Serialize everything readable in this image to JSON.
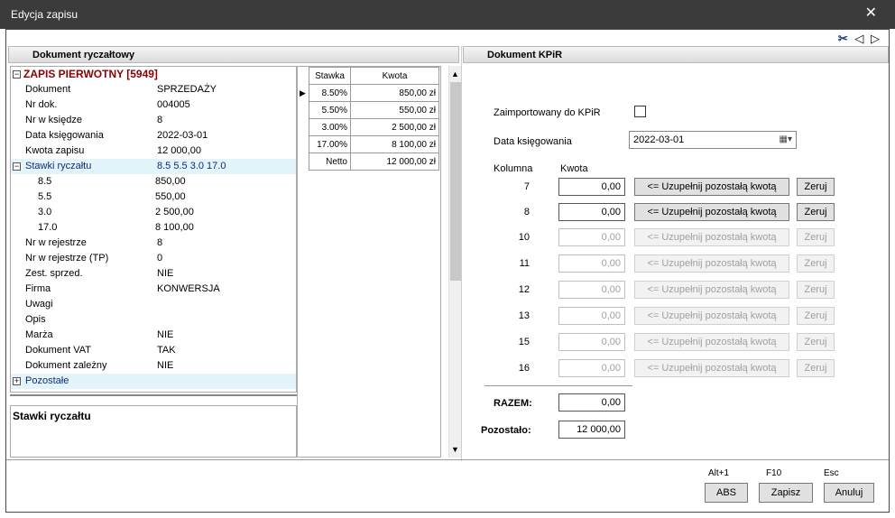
{
  "window": {
    "title": "Edycja zapisu",
    "close_glyph": "✕"
  },
  "toolbar": {
    "cut_icon": "✂",
    "prev_icon": "◁",
    "next_icon": "▷"
  },
  "left_panel": {
    "title": "Dokument ryczałtowy"
  },
  "right_panel": {
    "title": "Dokument KPiR"
  },
  "tree": {
    "root": {
      "label": "ZAPIS PIERWOTNY [5949]",
      "expander": "−"
    },
    "rows": [
      {
        "k": "Dokument",
        "v": "SPRZEDAŻY"
      },
      {
        "k": "Nr dok.",
        "v": "004005"
      },
      {
        "k": "Nr w księdze",
        "v": "8"
      },
      {
        "k": "Data księgowania",
        "v": "2022-03-01"
      },
      {
        "k": "Kwota zapisu",
        "v": " 12 000,00"
      }
    ],
    "stawki": {
      "k": "Stawki ryczałtu",
      "v": "8.5 5.5 3.0 17.0",
      "expander": "−"
    },
    "sub_rows": [
      {
        "k": "8.5",
        "v": "850,00"
      },
      {
        "k": "5.5",
        "v": "550,00"
      },
      {
        "k": "3.0",
        "v": " 2 500,00"
      },
      {
        "k": "17.0",
        "v": "8 100,00"
      }
    ],
    "rows2": [
      {
        "k": "Nr w rejestrze",
        "v": "8"
      },
      {
        "k": "Nr w rejestrze (TP)",
        "v": "0"
      },
      {
        "k": "Zest. sprzed.",
        "v": "NIE"
      },
      {
        "k": "Firma",
        "v": "KONWERSJA"
      },
      {
        "k": "Uwagi",
        "v": ""
      },
      {
        "k": "Opis",
        "v": ""
      },
      {
        "k": "Marża",
        "v": "NIE"
      },
      {
        "k": "Dokument VAT",
        "v": "TAK"
      },
      {
        "k": "Dokument zależny",
        "v": "NIE"
      }
    ],
    "pozostale": {
      "k": "Pozostałe",
      "expander": "+"
    }
  },
  "description": {
    "title": "Stawki ryczałtu"
  },
  "rates_table": {
    "headers": [
      "Stawka",
      "Kwota"
    ],
    "rows": [
      {
        "stawka": "8.50%",
        "kwota": "850,00 zł"
      },
      {
        "stawka": "5.50%",
        "kwota": "550,00 zł"
      },
      {
        "stawka": "3.00%",
        "kwota": "2 500,00 zł"
      },
      {
        "stawka": "17.00%",
        "kwota": "8 100,00 zł"
      },
      {
        "stawka": "Netto",
        "kwota": "12 000,00 zł"
      }
    ]
  },
  "kpir": {
    "imported_label": "Zaimportowany do KPiR",
    "date_label": "Data księgowania",
    "date_value": "2022-03-01",
    "col_header_kolumna": "Kolumna",
    "col_header_kwota": "Kwota",
    "fill_label": "<= Uzupełnij pozostałą kwotą",
    "zero_label": "Zeruj",
    "columns": [
      {
        "num": "7",
        "amount": "0,00",
        "enabled": true
      },
      {
        "num": "8",
        "amount": "0,00",
        "enabled": true
      },
      {
        "num": "10",
        "amount": "0,00",
        "enabled": false
      },
      {
        "num": "11",
        "amount": "0,00",
        "enabled": false
      },
      {
        "num": "12",
        "amount": "0,00",
        "enabled": false
      },
      {
        "num": "13",
        "amount": "0,00",
        "enabled": false
      },
      {
        "num": "15",
        "amount": "0,00",
        "enabled": false
      },
      {
        "num": "16",
        "amount": "0,00",
        "enabled": false
      }
    ],
    "razem_label": "RAZEM:",
    "razem_value": "0,00",
    "pozostalo_label": "Pozostało:",
    "pozostalo_value": "12 000,00"
  },
  "footer": {
    "abs": {
      "key": "Alt+1",
      "label": "ABS"
    },
    "save": {
      "key": "F10",
      "label": "Zapisz"
    },
    "cancel": {
      "key": "Esc",
      "label": "Anuluj"
    }
  }
}
